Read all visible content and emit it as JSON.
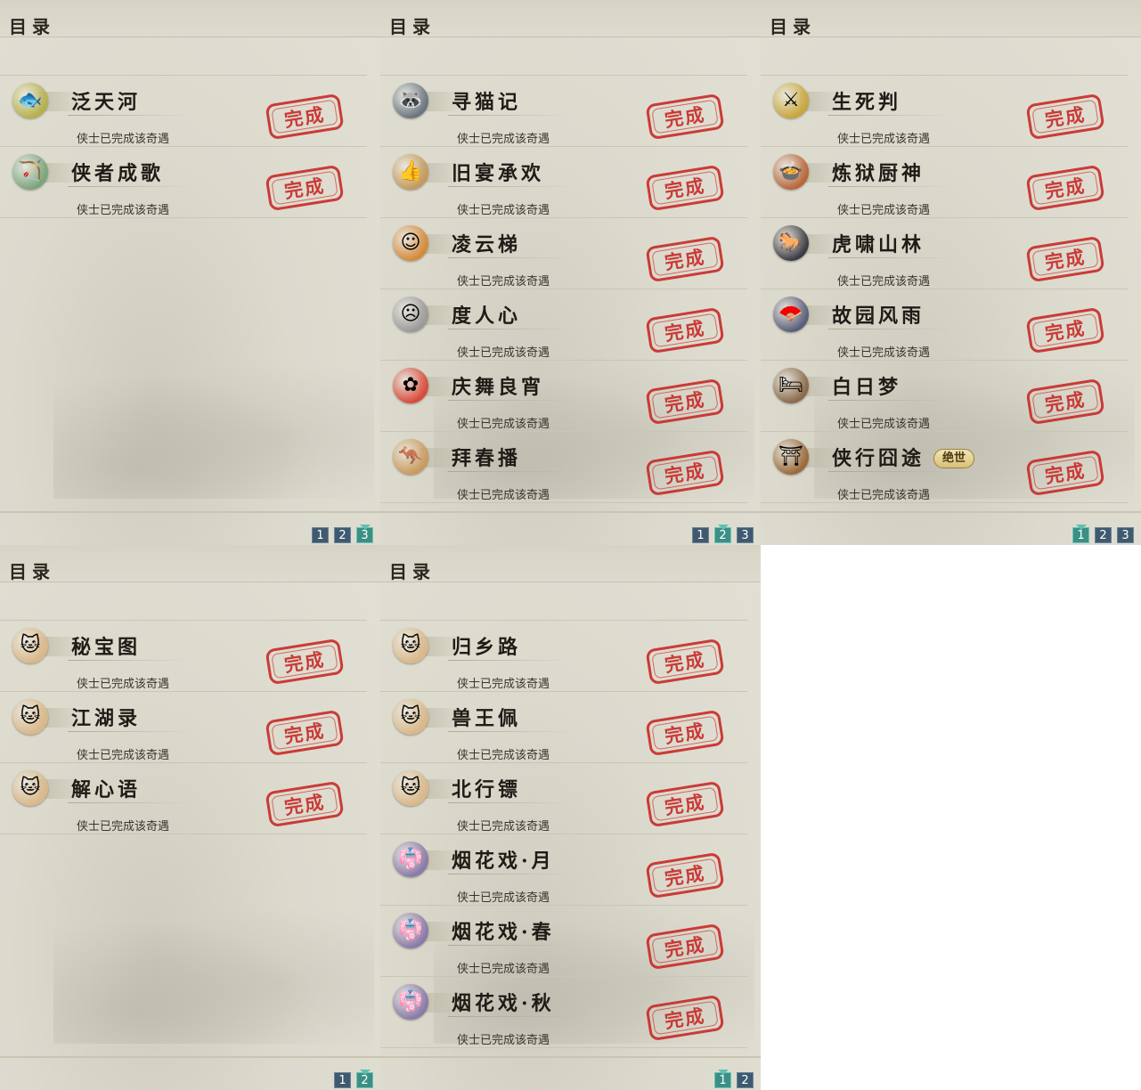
{
  "status_text": "侠士已完成该奇遇",
  "stamp_text": "完成",
  "panels": [
    {
      "title": "目录",
      "pages": [
        "1",
        "2",
        "3"
      ],
      "active_page": "3",
      "items": [
        {
          "name": "泛天河",
          "icon": "fish-mask-icon",
          "glyph": "🐟",
          "color": "#b6b04c"
        },
        {
          "name": "侠者成歌",
          "icon": "hero-scene-icon",
          "glyph": "🏹",
          "color": "#7aa57c"
        }
      ]
    },
    {
      "title": "目录",
      "pages": [
        "1",
        "2",
        "3"
      ],
      "active_page": "2",
      "items": [
        {
          "name": "寻猫记",
          "icon": "raccoon-icon",
          "glyph": "🦝",
          "color": "#6b7680"
        },
        {
          "name": "旧宴承欢",
          "icon": "thumbs-up-icon",
          "glyph": "👍",
          "color": "#c49a5a"
        },
        {
          "name": "凌云梯",
          "icon": "orange-face-icon",
          "glyph": "☺",
          "color": "#d58a3a"
        },
        {
          "name": "度人心",
          "icon": "mask-icon",
          "glyph": "☹",
          "color": "#9a9a9a"
        },
        {
          "name": "庆舞良宵",
          "icon": "lantern-icon",
          "glyph": "✿",
          "color": "#d94a3a"
        },
        {
          "name": "拜春播",
          "icon": "kangaroo-icon",
          "glyph": "🦘",
          "color": "#c99a5c"
        }
      ]
    },
    {
      "title": "目录",
      "pages": [
        "1",
        "2",
        "3"
      ],
      "active_page": "1",
      "items": [
        {
          "name": "生死判",
          "icon": "gold-sword-icon",
          "glyph": "⚔",
          "color": "#c9a63a"
        },
        {
          "name": "炼狱厨神",
          "icon": "hotpot-icon",
          "glyph": "🍲",
          "color": "#b8663a"
        },
        {
          "name": "虎啸山林",
          "icon": "black-horse-icon",
          "glyph": "🐎",
          "color": "#3c3c44"
        },
        {
          "name": "故园风雨",
          "icon": "fan-icon",
          "glyph": "🪭",
          "color": "#5a5e7a"
        },
        {
          "name": "白日梦",
          "icon": "bed-icon",
          "glyph": "🛏",
          "color": "#8a6a4a"
        },
        {
          "name": "侠行囧途",
          "icon": "pavilion-icon",
          "glyph": "⛩",
          "color": "#9a6a3a",
          "badge": "绝世"
        }
      ]
    },
    {
      "title": "目录",
      "pages": [
        "1",
        "2"
      ],
      "active_page": "2",
      "items": [
        {
          "name": "秘宝图",
          "icon": "cat-icon",
          "glyph": "🐱",
          "color": "#d9b889"
        },
        {
          "name": "江湖录",
          "icon": "cat-icon",
          "glyph": "🐱",
          "color": "#d9b889"
        },
        {
          "name": "解心语",
          "icon": "cat-icon",
          "glyph": "🐱",
          "color": "#d9b889"
        }
      ]
    },
    {
      "title": "目录",
      "pages": [
        "1",
        "2"
      ],
      "active_page": "1",
      "items": [
        {
          "name": "归乡路",
          "icon": "cat-icon",
          "glyph": "🐱",
          "color": "#d9b889"
        },
        {
          "name": "兽王佩",
          "icon": "cat-icon",
          "glyph": "🐱",
          "color": "#d9b889"
        },
        {
          "name": "北行镖",
          "icon": "cat-icon",
          "glyph": "🐱",
          "color": "#d9b889"
        },
        {
          "name": "烟花戏·月",
          "icon": "lady-portrait-icon",
          "glyph": "👘",
          "color": "#8a7aa8"
        },
        {
          "name": "烟花戏·春",
          "icon": "lady-portrait-icon",
          "glyph": "👘",
          "color": "#8a7aa8"
        },
        {
          "name": "烟花戏·秋",
          "icon": "lady-portrait-icon",
          "glyph": "👘",
          "color": "#8a7aa8"
        }
      ]
    }
  ]
}
